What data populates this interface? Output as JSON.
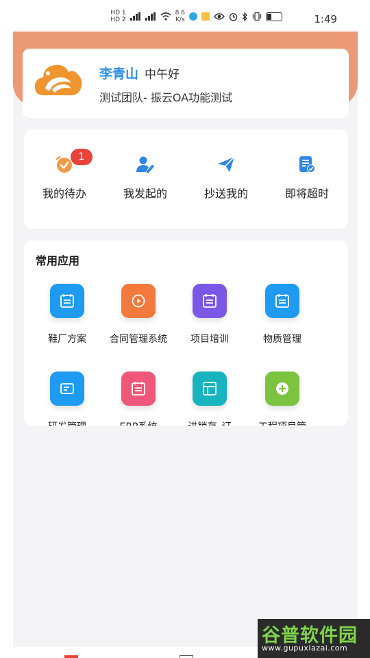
{
  "status_bar": {
    "sim1": "HD 1",
    "sim2": "HD 2",
    "net_speed_value": "8.6",
    "net_speed_unit": "K/s",
    "time": "1:49"
  },
  "user_card": {
    "name": "李青山",
    "greeting": "中午好",
    "team": "测试团队- 振云OA功能测试"
  },
  "tasks": {
    "items": [
      {
        "label": "我的待办",
        "badge": "1",
        "icon": "alarm-clock-icon",
        "color": "#f39a4a"
      },
      {
        "label": "我发起的",
        "icon": "user-edit-icon",
        "color": "#2f86e6"
      },
      {
        "label": "抄送我的",
        "icon": "paper-plane-icon",
        "color": "#2f86e6"
      },
      {
        "label": "即将超时",
        "icon": "document-check-icon",
        "color": "#2f86e6"
      }
    ]
  },
  "apps": {
    "title": "常用应用",
    "items": [
      {
        "label": "鞋厂方案",
        "icon": "calendar-icon",
        "color": "#1e9bf0"
      },
      {
        "label": "合同管理系统",
        "icon": "play-icon",
        "color": "#f27a3c"
      },
      {
        "label": "项目培训",
        "icon": "calendar-icon",
        "color": "#7b57e8"
      },
      {
        "label": "物质管理",
        "icon": "calendar-icon",
        "color": "#1e9bf0"
      },
      {
        "label": "研发管理",
        "icon": "document-icon",
        "color": "#1e9bf0"
      },
      {
        "label": "ERP系统",
        "icon": "calendar-icon",
        "color": "#f0577a"
      },
      {
        "label": "进销存_订",
        "icon": "layout-icon",
        "color": "#17b3be"
      },
      {
        "label": "工程项目管",
        "icon": "plus-circle-icon",
        "color": "#7cc33f"
      }
    ]
  },
  "watermark": {
    "title": "谷普软件园",
    "url": "www.gupuxiazai.com"
  },
  "colors": {
    "header": "#ec9a76",
    "accent_blue": "#2c8fe6",
    "badge_red": "#e8423a"
  }
}
